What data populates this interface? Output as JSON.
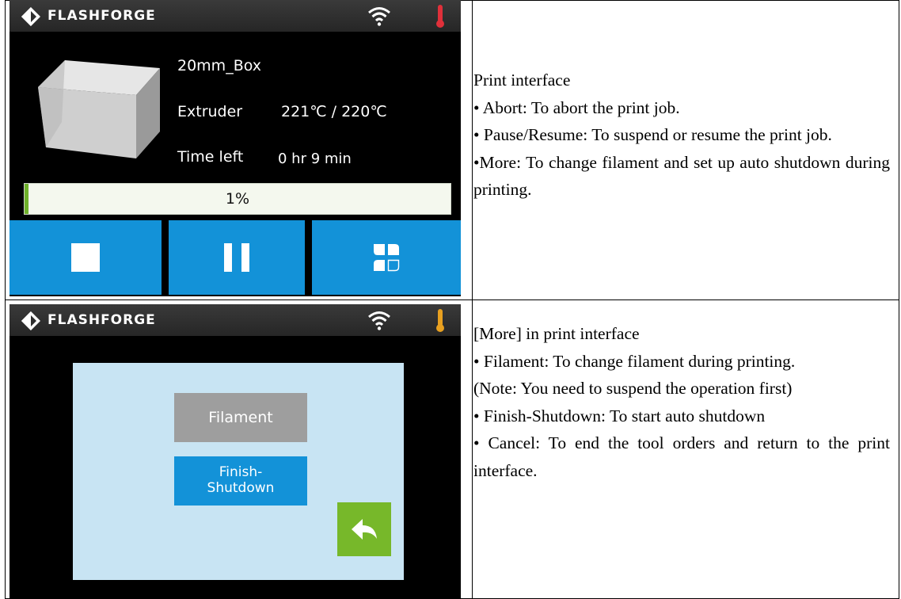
{
  "brand": "FLASHFORGE",
  "print_screen": {
    "file_name": "20mm_Box",
    "extruder_label": "Extruder",
    "extruder_temp": "221℃ / 220℃",
    "time_left_label": "Time left",
    "time_left_value": "0 hr 9 min",
    "progress_label": "1%",
    "progress_fraction": 0.01,
    "buttons": [
      "stop-icon",
      "pause-icon",
      "more-icon"
    ],
    "thermometer_color": "#e0303a"
  },
  "more_screen": {
    "filament_button": "Filament",
    "shutdown_line1": "Finish-",
    "shutdown_line2": "Shutdown",
    "back_icon": "back-arrow-icon",
    "thermometer_color": "#e8a020"
  },
  "descriptions": {
    "print": {
      "heading": "Print interface",
      "items": [
        "• Abort: To abort the print job.",
        "• Pause/Resume: To suspend or resume the print job.",
        "•More: To change filament and set up auto shutdown during printing."
      ]
    },
    "more": {
      "heading": "[More] in print interface",
      "items": [
        "• Filament: To change filament during printing.",
        "(Note: You need to suspend the operation first)",
        "• Finish-Shutdown: To start auto shutdown",
        "• Cancel: To end the tool orders and return to the print interface."
      ]
    }
  },
  "colors": {
    "accent_blue": "#1392d8",
    "progress_green": "#6fb12b",
    "back_green": "#77b82a",
    "dialog_bg": "#c8e4f3"
  }
}
